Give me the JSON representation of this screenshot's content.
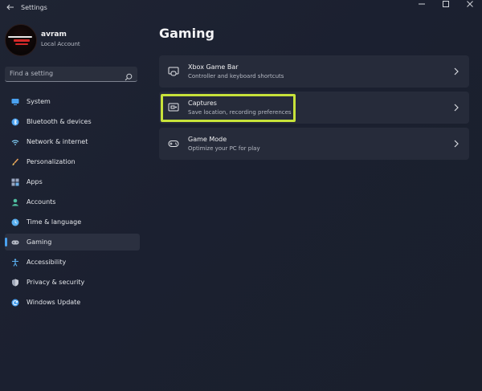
{
  "window": {
    "title": "Settings"
  },
  "profile": {
    "name": "avram",
    "account_type": "Local Account"
  },
  "search": {
    "placeholder": "Find a setting"
  },
  "nav": {
    "items": [
      {
        "label": "System",
        "icon": "monitor-icon",
        "color": "#4aa1f0"
      },
      {
        "label": "Bluetooth & devices",
        "icon": "bluetooth-icon",
        "color": "#4aa1f0"
      },
      {
        "label": "Network & internet",
        "icon": "wifi-icon",
        "color": "#7ec8f0"
      },
      {
        "label": "Personalization",
        "icon": "brush-icon",
        "color": "#e8a05a"
      },
      {
        "label": "Apps",
        "icon": "apps-icon",
        "color": "#9aa7c0"
      },
      {
        "label": "Accounts",
        "icon": "person-icon",
        "color": "#4fc0a0"
      },
      {
        "label": "Time & language",
        "icon": "globe-clock-icon",
        "color": "#5ab0f0"
      },
      {
        "label": "Gaming",
        "icon": "gamepad-icon",
        "color": "#b8bcc6",
        "active": true
      },
      {
        "label": "Accessibility",
        "icon": "accessibility-icon",
        "color": "#5ab0f0"
      },
      {
        "label": "Privacy & security",
        "icon": "shield-icon",
        "color": "#a0a8b8"
      },
      {
        "label": "Windows Update",
        "icon": "update-icon",
        "color": "#4aa1f0"
      }
    ]
  },
  "page": {
    "title": "Gaming"
  },
  "cards": [
    {
      "title": "Xbox Game Bar",
      "subtitle": "Controller and keyboard shortcuts",
      "icon": "game-bar-icon"
    },
    {
      "title": "Captures",
      "subtitle": "Save location, recording preferences",
      "icon": "capture-icon",
      "highlighted": true
    },
    {
      "title": "Game Mode",
      "subtitle": "Optimize your PC for play",
      "icon": "game-mode-icon"
    }
  ],
  "colors": {
    "accent": "#4aa1f0",
    "highlight": "#c7e23a"
  }
}
